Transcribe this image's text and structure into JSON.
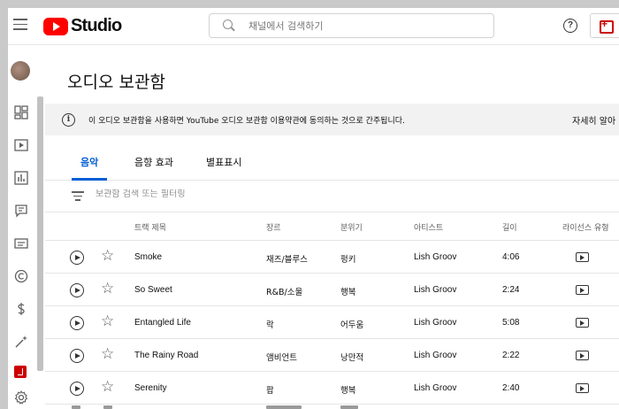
{
  "header": {
    "logo_text": "Studio",
    "search_placeholder": "채널에서 검색하기",
    "help_symbol": "?"
  },
  "page": {
    "title": "오디오 보관함",
    "notice": "이 오디오 보관함을 사용하면 YouTube 오디오 보관함 이용약관에 동의하는 것으로 간주됩니다.",
    "notice_link": "자세히 알아"
  },
  "tabs": [
    {
      "label": "음악",
      "active": true
    },
    {
      "label": "음향 효과",
      "active": false
    },
    {
      "label": "별표표시",
      "active": false
    }
  ],
  "filter": {
    "placeholder": "보관함 검색 또는 필터링"
  },
  "table": {
    "columns": [
      "트랙 제목",
      "장르",
      "분위기",
      "아티스트",
      "길이",
      "라이선스 유형"
    ],
    "rows": [
      {
        "title": "Smoke",
        "genre": "재즈/블루스",
        "mood": "펑키",
        "artist": "Lish Groov",
        "length": "4:06"
      },
      {
        "title": "So Sweet",
        "genre": "R&B/소울",
        "mood": "행복",
        "artist": "Lish Groov",
        "length": "2:24"
      },
      {
        "title": "Entangled Life",
        "genre": "락",
        "mood": "어두움",
        "artist": "Lish Groov",
        "length": "5:08"
      },
      {
        "title": "The Rainy Road",
        "genre": "앰비언트",
        "mood": "낭만적",
        "artist": "Lish Groov",
        "length": "2:22"
      },
      {
        "title": "Serenity",
        "genre": "팝",
        "mood": "행복",
        "artist": "Lish Groov",
        "length": "2:40"
      }
    ]
  },
  "colors": {
    "accent": "#065fd4",
    "brand": "#ff0000"
  }
}
